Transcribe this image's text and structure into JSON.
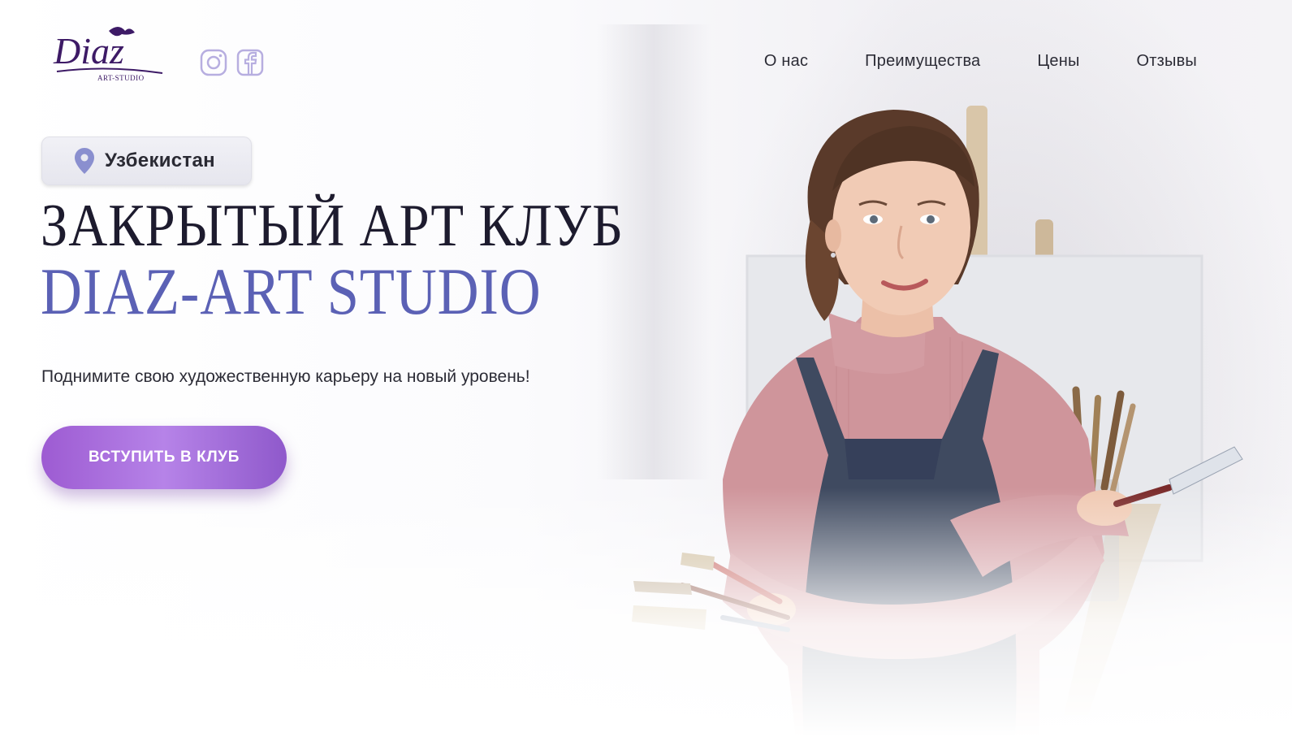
{
  "brand": {
    "logo_main": "Diaz",
    "logo_sub": "ART-STUDIO"
  },
  "social": {
    "instagram_icon": "instagram-icon",
    "facebook_icon": "facebook-icon"
  },
  "nav": {
    "items": [
      {
        "label": "О нас"
      },
      {
        "label": "Преимущества"
      },
      {
        "label": "Цены"
      },
      {
        "label": "Отзывы"
      }
    ]
  },
  "location": {
    "icon": "map-pin-icon",
    "label": "Узбекистан"
  },
  "hero": {
    "title_line1": "ЗАКРЫТЫЙ АРТ КЛУБ",
    "title_line2": "DIAZ-ART STUDIO",
    "subtitle": "Поднимите свою художественную карьеру на новый уровень!",
    "cta_label": "ВСТУПИТЬ В КЛУБ"
  },
  "colors": {
    "accent": "#5b61b5",
    "button_start": "#9d5bd2",
    "button_end": "#8f59cb",
    "icon_lilac": "#b7aee0"
  }
}
